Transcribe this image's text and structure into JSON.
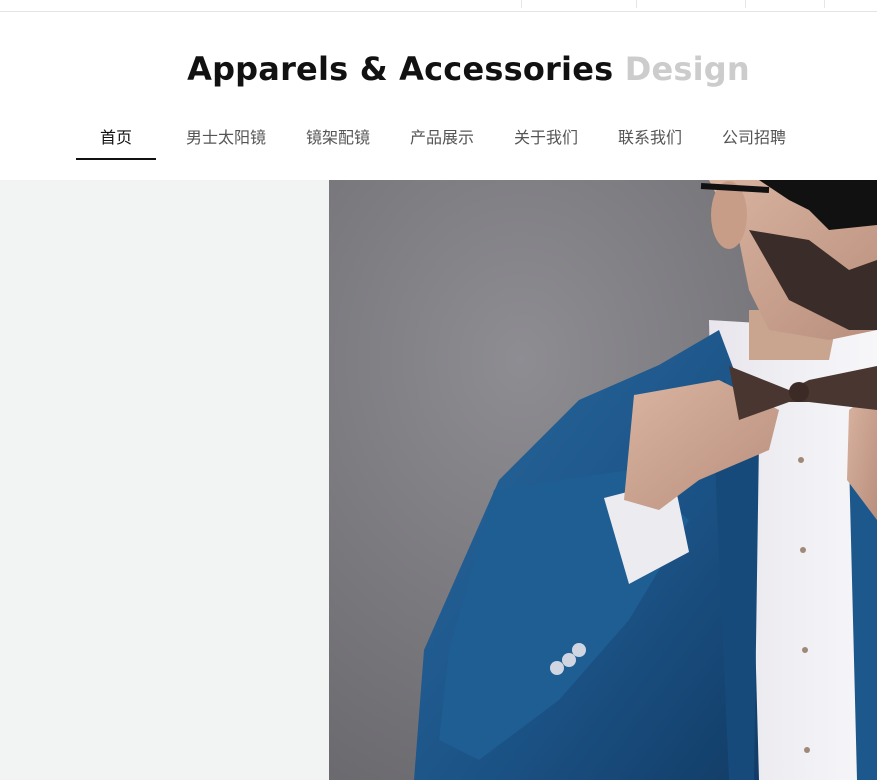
{
  "brand": {
    "title_main": "Apparels & Accessories",
    "title_accent": "Design"
  },
  "nav": {
    "items": [
      {
        "label": "首页",
        "active": true
      },
      {
        "label": "男士太阳镜",
        "active": false
      },
      {
        "label": "镜架配镜",
        "active": false
      },
      {
        "label": "产品展示",
        "active": false
      },
      {
        "label": "关于我们",
        "active": false
      },
      {
        "label": "联系我们",
        "active": false
      },
      {
        "label": "公司招聘",
        "active": false
      }
    ]
  },
  "hero": {
    "image_subject": "man-in-blue-suit-with-bow-tie-and-sunglasses"
  },
  "colors": {
    "brand_text": "#111111",
    "brand_accent": "#cccccc",
    "nav_text": "#555555",
    "nav_active": "#111111",
    "hero_left_bg": "#f2f4f3",
    "photo_wall": "#7a797e",
    "suit_blue": "#1f5a8c"
  }
}
